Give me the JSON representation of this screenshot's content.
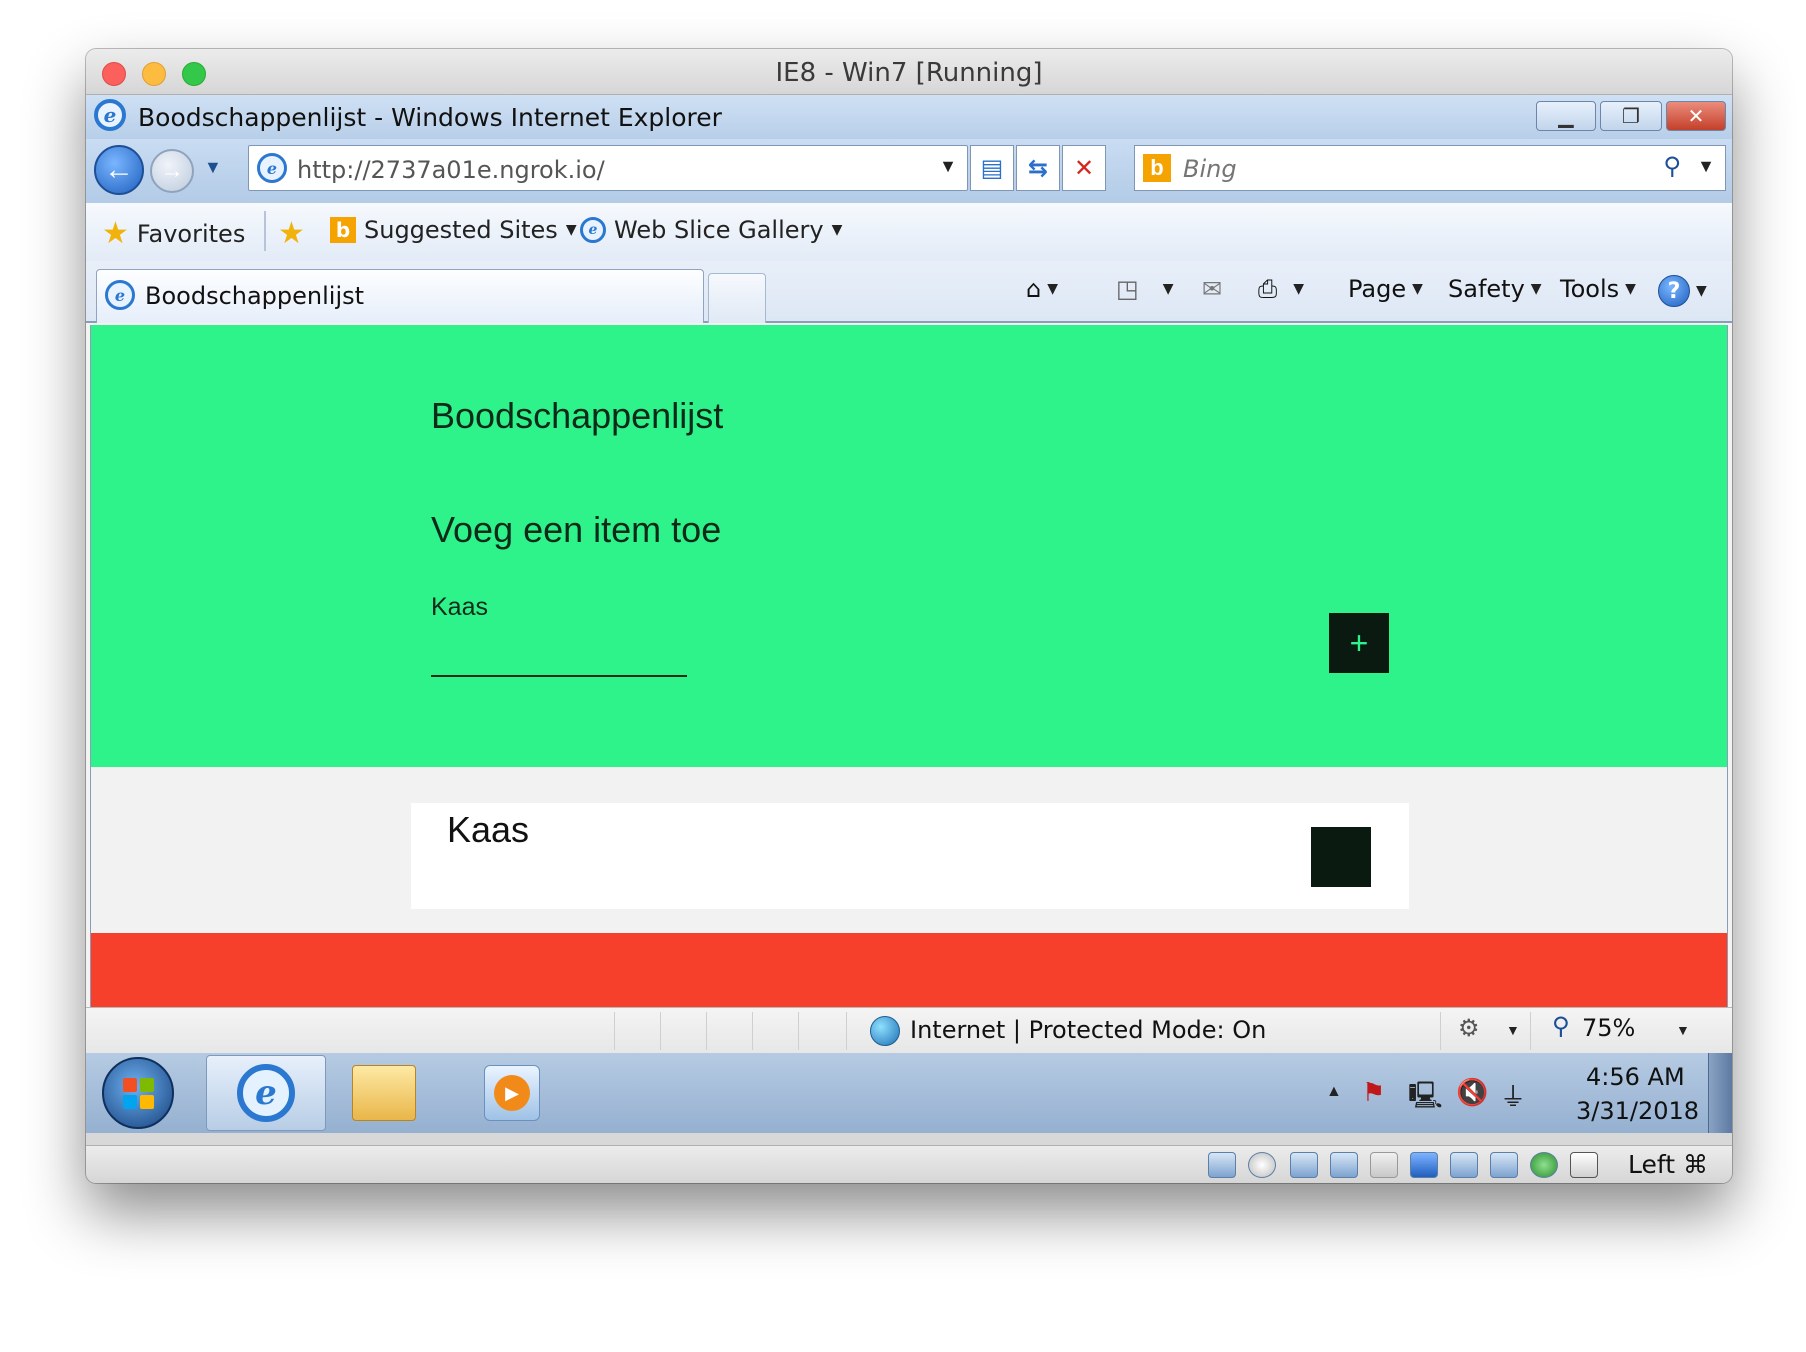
{
  "vbox": {
    "title": "IE8 - Win7 [Running]",
    "host_key": "Left ⌘"
  },
  "ie": {
    "window_title": "Boodschappenlijst - Windows Internet Explorer",
    "address": "http://2737a01e.ngrok.io/",
    "search_placeholder": "Bing",
    "favorites": {
      "label": "Favorites",
      "items": [
        "Suggested Sites",
        "Web Slice Gallery"
      ]
    },
    "tab_title": "Boodschappenlijst",
    "commands": [
      "Page",
      "Safety",
      "Tools"
    ],
    "status": {
      "zone": "Internet | Protected Mode: On",
      "zoom": "75%"
    }
  },
  "page": {
    "title": "Boodschappenlijst",
    "form_title": "Voeg een item toe",
    "item_label": "Kaas",
    "add_button": "+",
    "list": [
      {
        "text": "Kaas"
      }
    ],
    "colors": {
      "hero": "#2ef28a",
      "button": "#0b1a10",
      "footer": "#f6402c"
    }
  },
  "taskbar": {
    "time": "4:56 AM",
    "date": "3/31/2018"
  }
}
